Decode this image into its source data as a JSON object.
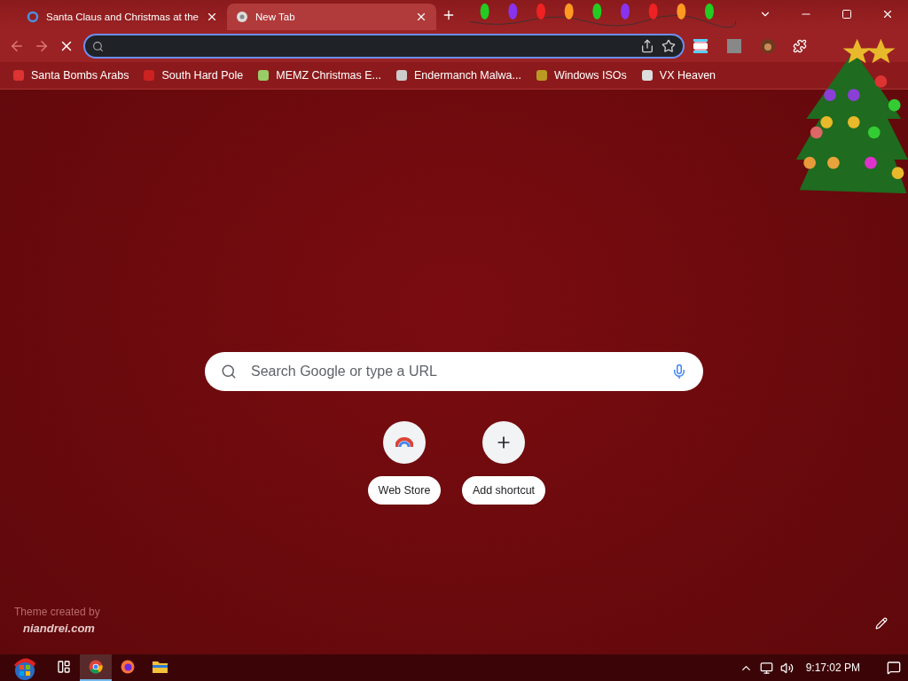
{
  "tabs": [
    {
      "title": "Santa Claus and Christmas at the",
      "selected": false,
      "loading": true
    },
    {
      "title": "New Tab",
      "selected": true,
      "loading": false
    }
  ],
  "bookmarks": [
    {
      "label": "Santa Bombs Arabs"
    },
    {
      "label": "South Hard Pole"
    },
    {
      "label": "MEMZ Christmas E..."
    },
    {
      "label": "Endermanch Malwa..."
    },
    {
      "label": "Windows ISOs"
    },
    {
      "label": "VX Heaven"
    }
  ],
  "search": {
    "placeholder": "Search Google or type a URL"
  },
  "shortcuts": [
    {
      "label": "Web Store",
      "kind": "store"
    },
    {
      "label": "Add shortcut",
      "kind": "add"
    }
  ],
  "theme_credit": {
    "text": "Theme created by",
    "link": "niandrei.com"
  },
  "taskbar": {
    "apps": [
      {
        "kind": "taskview",
        "selected": false
      },
      {
        "kind": "chrome",
        "selected": true
      },
      {
        "kind": "firefox",
        "selected": false
      },
      {
        "kind": "folder",
        "selected": false
      }
    ],
    "clock": "9:17:02 PM"
  }
}
